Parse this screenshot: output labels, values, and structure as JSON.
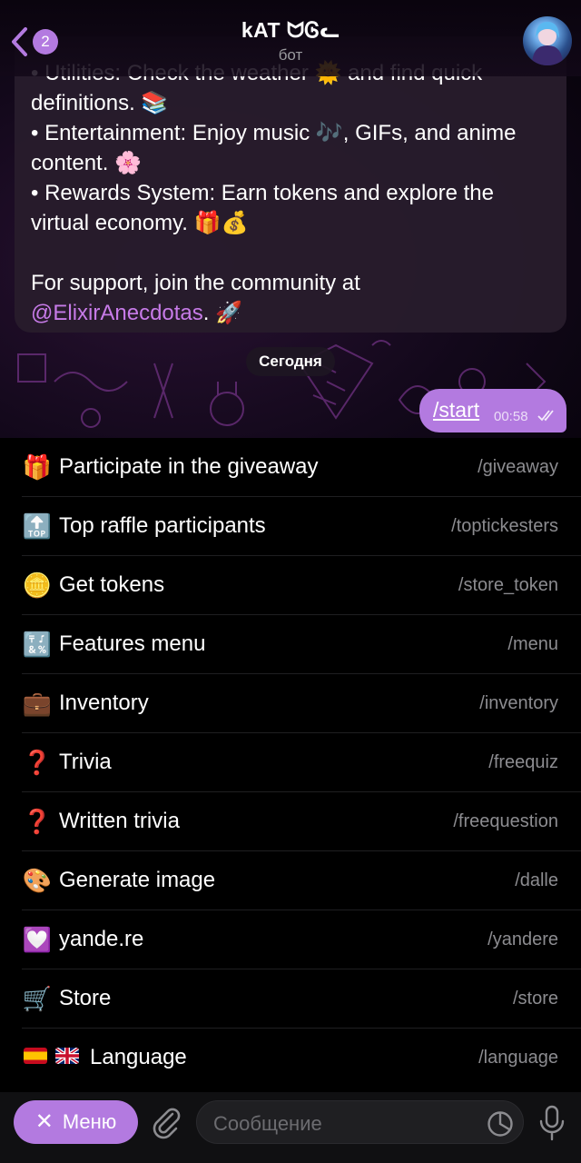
{
  "header": {
    "back_count": "2",
    "title": "kAT ᗢᎶᓚ",
    "subtitle": "бот"
  },
  "message_in": {
    "lines": [
      "• Utilities: Check the weather 🌞 and find quick",
      "definitions. 📚",
      "• Entertainment: Enjoy music 🎶, GIFs, and anime",
      "content. 🌸",
      "• Rewards System: Earn tokens and explore the",
      "virtual economy. 🎁💰",
      "",
      "For support, join the community at"
    ],
    "mention": "@ElixirAnecdotas",
    "tail": ". 🚀"
  },
  "date_pill": "Сегодня",
  "message_out": {
    "text": "/start",
    "time": "00:58"
  },
  "commands": [
    {
      "emoji": "🎁",
      "label": "Participate in the giveaway",
      "command": "/giveaway"
    },
    {
      "emoji": "🔝",
      "label": "Top raffle participants",
      "command": "/toptickesters"
    },
    {
      "emoji": "🪙",
      "label": "Get tokens",
      "command": "/store_token"
    },
    {
      "emoji": "🔣",
      "label": "Features menu",
      "command": "/menu"
    },
    {
      "emoji": "💼",
      "label": "Inventory",
      "command": "/inventory"
    },
    {
      "emoji": "❓",
      "label": "Trivia",
      "command": "/freequiz"
    },
    {
      "emoji": "❓",
      "label": "Written trivia",
      "command": "/freequestion"
    },
    {
      "emoji": "🎨",
      "label": "Generate image",
      "command": "/dalle"
    },
    {
      "emoji": "💟",
      "label": "yande.re",
      "command": "/yandere"
    },
    {
      "emoji": "🛒",
      "label": "Store",
      "command": "/store"
    },
    {
      "emoji": "🇪🇸🇬🇧",
      "label": "Language",
      "command": "/language"
    }
  ],
  "bottom": {
    "menu_close": "✕",
    "menu_label": "Меню",
    "input_placeholder": "Сообщение"
  },
  "colors": {
    "accent": "#b37ae0",
    "background": "#000000",
    "bubble_in": "#281c2c",
    "mention": "#c77be8",
    "muted": "#8c8c90"
  }
}
